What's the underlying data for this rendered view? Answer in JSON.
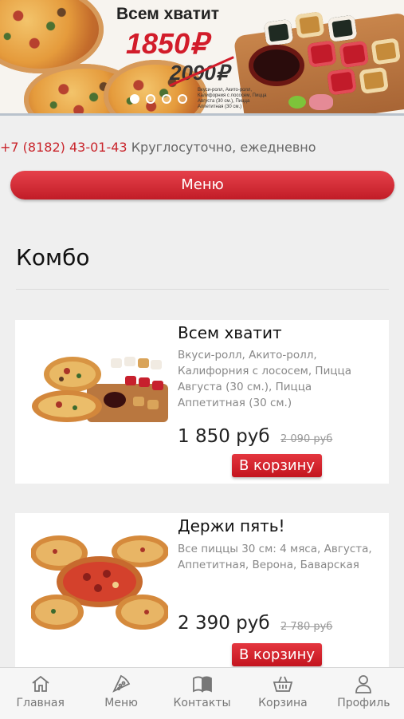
{
  "banner": {
    "title": "Всем хватит",
    "price": "1850₽",
    "old_price": "2090₽",
    "description": "Вкуси-ролл, Акито-ролл, Калифорния с лососем, Пицца Августа (30 см.), Пицца Аппетитная (30 см.)",
    "slides_total": 4,
    "active_slide": 1
  },
  "contact": {
    "phone": "+7 (8182) 43-01-43",
    "hours": "Круглосуточно, ежедневно"
  },
  "menu_button": "Меню",
  "section_title": "Комбо",
  "products": [
    {
      "title": "Всем хватит",
      "description": "Вкуси-ролл, Акито-ролл, Калифорния с лососем, Пицца Августа (30 см.), Пицца Аппетитная (30 см.)",
      "price": "1 850 руб",
      "old_price": "2 090 руб",
      "button": "В корзину"
    },
    {
      "title": "Держи пять!",
      "description": "Все пиццы 30 см: 4 мяса, Августа, Аппетитная, Верона, Баварская",
      "price": "2 390 руб",
      "old_price": "2 780 руб",
      "button": "В корзину"
    }
  ],
  "tabbar": [
    {
      "label": "Главная",
      "icon": "home-icon"
    },
    {
      "label": "Меню",
      "icon": "pizza-slice-icon"
    },
    {
      "label": "Контакты",
      "icon": "book-icon"
    },
    {
      "label": "Корзина",
      "icon": "basket-icon"
    },
    {
      "label": "Профиль",
      "icon": "user-icon"
    }
  ],
  "colors": {
    "accent": "#c9242b",
    "background": "#efefef"
  }
}
